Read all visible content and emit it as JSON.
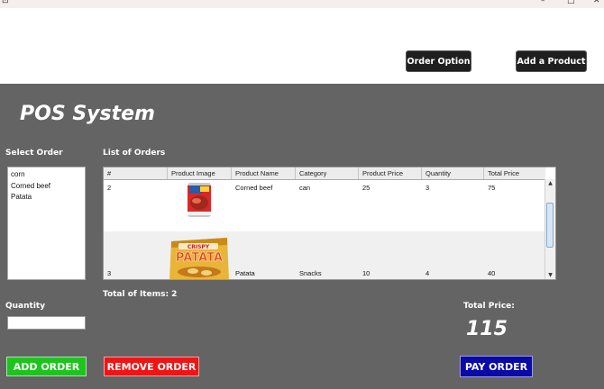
{
  "topbar": {
    "order_option_label": "Order Option",
    "add_product_label": "Add a Product"
  },
  "app": {
    "title": "POS System"
  },
  "select_order": {
    "label": "Select Order",
    "items": [
      "corn",
      "Corned beef",
      "Patata"
    ]
  },
  "orders": {
    "label": "List of Orders",
    "columns": [
      "#",
      "Product Image",
      "Product Name",
      "Category",
      "Product Price",
      "Quantity",
      "Total Price"
    ],
    "rows": [
      {
        "num": "2",
        "image": "corned-beef-can-image",
        "name": "Corned beef",
        "category": "can",
        "price": "25",
        "quantity": "3",
        "total": "75"
      },
      {
        "num": "3",
        "image": "patata-chips-image",
        "name": "Patata",
        "category": "Snacks",
        "price": "10",
        "quantity": "4",
        "total": "40"
      }
    ],
    "total_items_label": "Total of Items: 2"
  },
  "quantity": {
    "label": "Quantity",
    "value": ""
  },
  "totals": {
    "label": "Total Price:",
    "value": "115"
  },
  "actions": {
    "add_order_label": "ADD ORDER",
    "remove_order_label": "REMOVE ORDER",
    "pay_order_label": "PAY ORDER"
  },
  "colors": {
    "background": "#646464",
    "add": "#1ec41e",
    "remove": "#f01414",
    "pay": "#0a0aa8"
  }
}
